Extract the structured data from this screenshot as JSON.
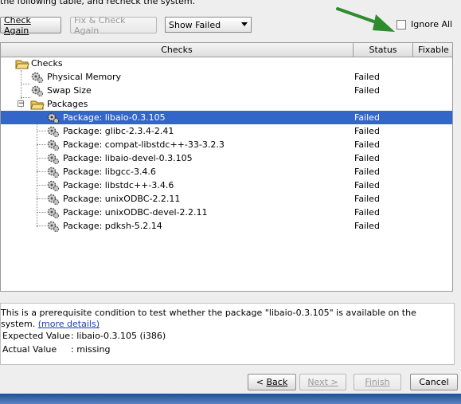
{
  "intro_text": "the following table, and recheck the system.",
  "toolbar": {
    "check_again": "Check Again",
    "fix_check_again": "Fix & Check Again",
    "filter_value": "Show Failed",
    "ignore_all": "Ignore All"
  },
  "table": {
    "headers": [
      "Checks",
      "Status",
      "Fixable"
    ],
    "rows": [
      {
        "label": "Checks",
        "status": ""
      },
      {
        "label": "Physical Memory",
        "status": "Failed"
      },
      {
        "label": "Swap Size",
        "status": "Failed"
      },
      {
        "label": "Packages",
        "status": ""
      },
      {
        "label": "Package: libaio-0.3.105",
        "status": "Failed"
      },
      {
        "label": "Package: glibc-2.3.4-2.41",
        "status": "Failed"
      },
      {
        "label": "Package: compat-libstdc++-33-3.2.3",
        "status": "Failed"
      },
      {
        "label": "Package: libaio-devel-0.3.105",
        "status": "Failed"
      },
      {
        "label": "Package: libgcc-3.4.6",
        "status": "Failed"
      },
      {
        "label": "Package: libstdc++-3.4.6",
        "status": "Failed"
      },
      {
        "label": "Package: unixODBC-2.2.11",
        "status": "Failed"
      },
      {
        "label": "Package: unixODBC-devel-2.2.11",
        "status": "Failed"
      },
      {
        "label": "Package: pdksh-5.2.14",
        "status": "Failed"
      }
    ]
  },
  "details": {
    "description": "This is a prerequisite condition to test whether the package \"libaio-0.3.105\" is available on the system.",
    "more_details": "(more details)",
    "expected_label": "Expected Value",
    "expected_value": ": libaio-0.3.105 (i386)",
    "actual_label": "Actual Value",
    "actual_value": ": missing"
  },
  "footer": {
    "back": "Back",
    "next": "Next >",
    "finish": "Finish",
    "cancel": "Cancel"
  },
  "colors": {
    "selection": "#3366c8",
    "annotation_arrow": "#2e8b2e",
    "link": "#1a3fb0"
  }
}
